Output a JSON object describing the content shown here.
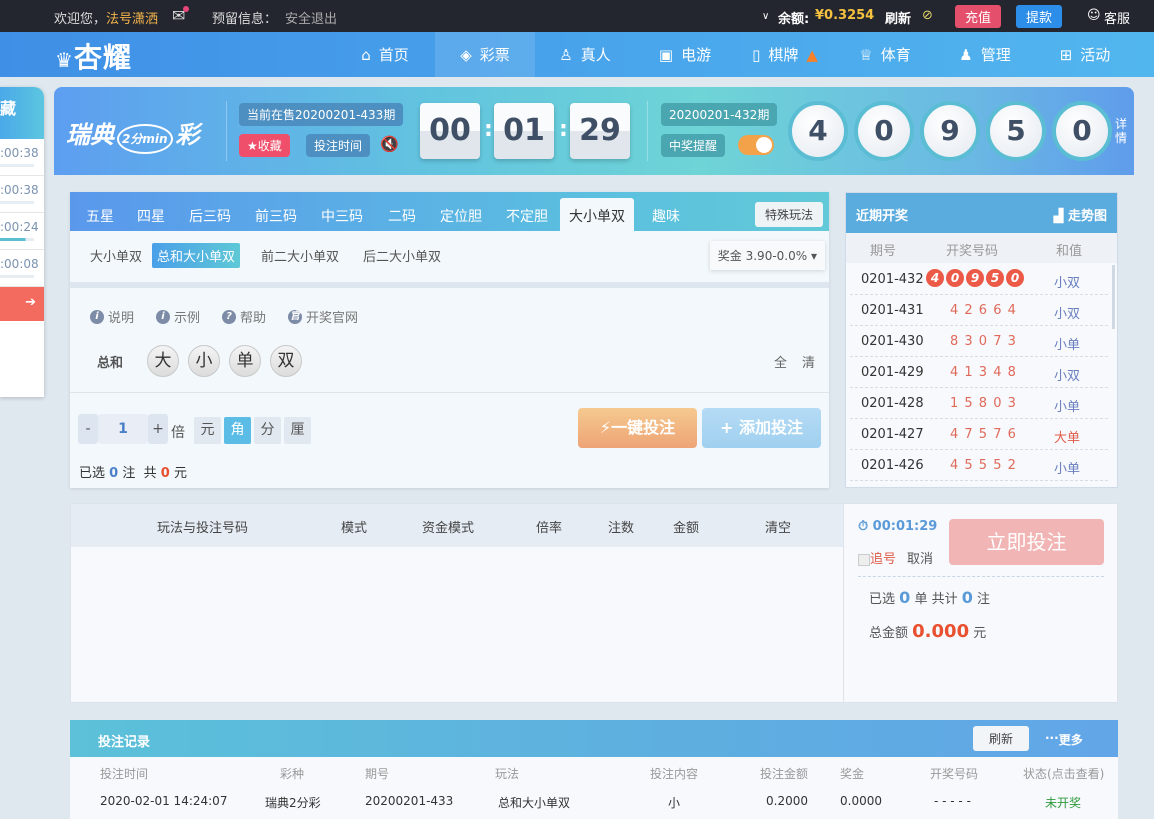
{
  "topbar": {
    "welcome": "欢迎您，",
    "username": "法号潇洒",
    "reserved": "预留信息：",
    "logout": "安全退出",
    "balance_label": "余额:",
    "balance": "¥0.3254",
    "refresh": "刷新",
    "recharge": "充值",
    "withdraw": "提款",
    "service": "客服"
  },
  "nav": {
    "logo": "杏耀",
    "items": [
      "首页",
      "彩票",
      "真人",
      "电游",
      "棋牌",
      "体育",
      "管理",
      "活动"
    ]
  },
  "side": {
    "title": "藏",
    "times": [
      ":00:38",
      ":00:38",
      ":00:24",
      ":00:08"
    ],
    "progress": [
      0,
      0,
      0.75,
      0
    ]
  },
  "lottery": {
    "name": "瑞典",
    "name2": "彩",
    "logo_sub": "2分min",
    "current": "当前在售20200201-433期",
    "favorite": "收藏",
    "bet_time": "投注时间",
    "countdown": [
      "00",
      "01",
      "29"
    ],
    "last_issue": "20200201-432期",
    "win_remind": "中奖提醒",
    "last_result": [
      "4",
      "0",
      "9",
      "5",
      "0"
    ],
    "detail": "详情"
  },
  "play": {
    "tabs": [
      "五星",
      "四星",
      "后三码",
      "前三码",
      "中三码",
      "二码",
      "定位胆",
      "不定胆",
      "大小单双",
      "趣味"
    ],
    "active_tab": 8,
    "special": "特殊玩法",
    "subtabs": [
      "大小单双",
      "总和大小单双",
      "前二大小单双",
      "后二大小单双"
    ],
    "active_sub": 1,
    "prize": "奖金 3.90-0.0%",
    "help": [
      "说明",
      "示例",
      "帮助",
      "开奖官网"
    ],
    "row_label": "总和",
    "choices": [
      "大",
      "小",
      "单",
      "双"
    ],
    "all": "全",
    "clear": "清",
    "multiple": "1",
    "times_label": "倍",
    "units": [
      "元",
      "角",
      "分",
      "厘"
    ],
    "active_unit": 1,
    "quick_bet": "一键投注",
    "add_bet": "添加投注",
    "selected_prefix": "已选",
    "selected_count": "0",
    "selected_unit": "注",
    "total_prefix": "共",
    "total": "0",
    "total_unit": "元"
  },
  "recent": {
    "title": "近期开奖",
    "trend": "走势图",
    "cols": [
      "期号",
      "开奖号码",
      "和值"
    ],
    "rows": [
      {
        "issue": "0201-432",
        "nums": "40950",
        "sum": "小双"
      },
      {
        "issue": "0201-431",
        "nums": "4 2 6 6 4",
        "sum": "小双"
      },
      {
        "issue": "0201-430",
        "nums": "8 3 0 7 3",
        "sum": "小单"
      },
      {
        "issue": "0201-429",
        "nums": "4 1 3 4 8",
        "sum": "小双"
      },
      {
        "issue": "0201-428",
        "nums": "1 5 8 0 3",
        "sum": "小单"
      },
      {
        "issue": "0201-427",
        "nums": "4 7 5 7 6",
        "sum": "大单"
      },
      {
        "issue": "0201-426",
        "nums": "4 5 5 5 2",
        "sum": "小单"
      }
    ]
  },
  "betlist": {
    "cols": [
      "玩法与投注号码",
      "模式",
      "资金模式",
      "倍率",
      "注数",
      "金额",
      "清空"
    ]
  },
  "submit": {
    "timer": "00:01:29",
    "chase": "追号",
    "cancel": "取消",
    "submit": "立即投注",
    "sel_prefix": "已选",
    "sel_count": "0",
    "sel_mid": "单 共计",
    "bet_count": "0",
    "bet_unit": "注",
    "total_label": "总金额",
    "total": "0.000",
    "total_unit": "元"
  },
  "records": {
    "title": "投注记录",
    "refresh": "刷新",
    "more": "更多",
    "cols": [
      "投注时间",
      "彩种",
      "期号",
      "玩法",
      "投注内容",
      "投注金额",
      "奖金",
      "开奖号码",
      "状态(点击查看)"
    ],
    "rows": [
      [
        "2020-02-01 14:24:07",
        "瑞典2分彩",
        "20200201-433",
        "总和大小单双",
        "小",
        "0.2000",
        "0.0000",
        "- - - - -",
        "未开奖"
      ]
    ]
  }
}
